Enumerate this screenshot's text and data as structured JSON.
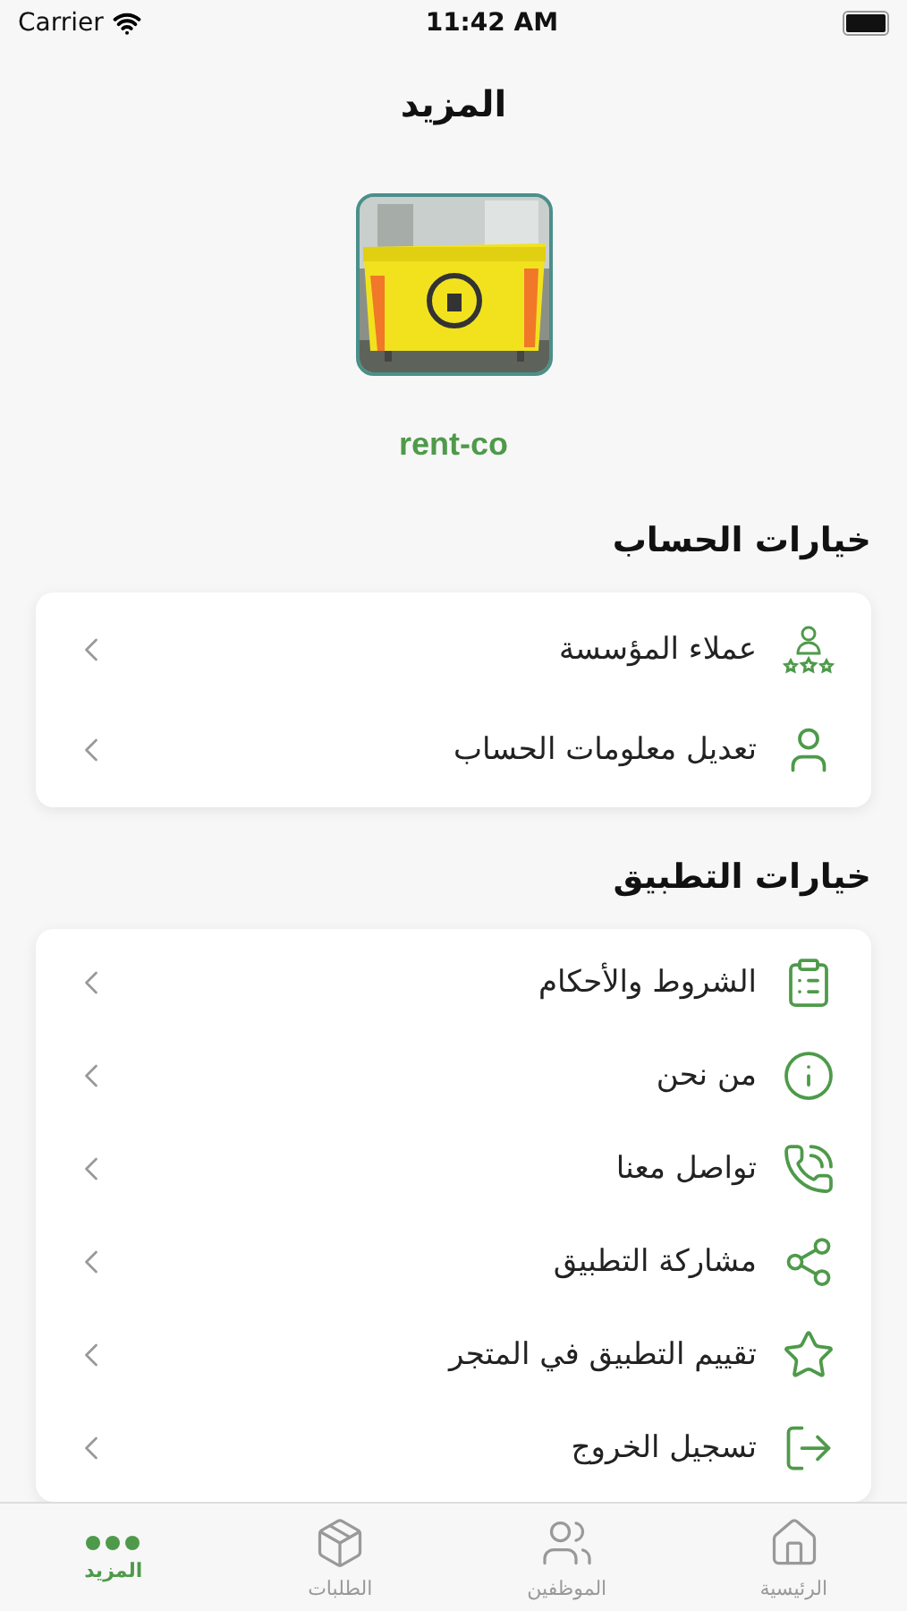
{
  "status_bar": {
    "carrier": "Carrier",
    "time": "11:42 AM"
  },
  "title": "المزيد",
  "profile": {
    "name": "rent-co"
  },
  "sections": [
    {
      "title": "خيارات الحساب",
      "items": [
        {
          "label": "عملاء المؤسسة",
          "kind": "clients"
        },
        {
          "label": "تعديل معلومات الحساب",
          "kind": "user"
        }
      ]
    },
    {
      "title": "خيارات التطبيق",
      "items": [
        {
          "label": "الشروط والأحكام",
          "kind": "terms"
        },
        {
          "label": "من نحن",
          "kind": "info"
        },
        {
          "label": "تواصل معنا",
          "kind": "contact"
        },
        {
          "label": "مشاركة التطبيق",
          "kind": "share"
        },
        {
          "label": "تقييم التطبيق في المتجر",
          "kind": "rate"
        },
        {
          "label": "تسجيل الخروج",
          "kind": "logout"
        }
      ]
    }
  ],
  "tabs": [
    {
      "label": "الرئيسية",
      "kind": "home",
      "selected": false
    },
    {
      "label": "الموظفين",
      "kind": "staff",
      "selected": false
    },
    {
      "label": "الطلبات",
      "kind": "orders",
      "selected": false
    },
    {
      "label": "المزيد",
      "kind": "more",
      "selected": true
    }
  ]
}
